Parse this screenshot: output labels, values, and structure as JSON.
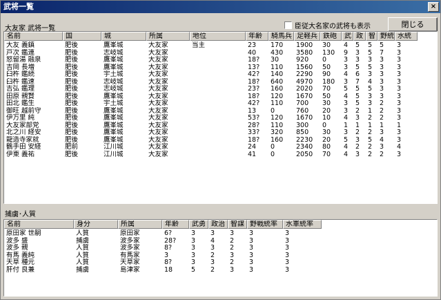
{
  "window": {
    "title": "武将一覧",
    "close_glyph": "×"
  },
  "top": {
    "section_label": "大友家 武将一覧",
    "checkbox_label": "臣従大名家の武将も表示",
    "close_button": "閉じる"
  },
  "officers": {
    "columns": [
      "名前",
      "国",
      "城",
      "所属",
      "地位",
      "年齢",
      "騎馬兵",
      "足軽兵",
      "鉄砲",
      "武",
      "政",
      "智",
      "野統",
      "水統"
    ],
    "rows": [
      [
        "大友 義鎮",
        "肥後",
        "鷹峯城",
        "大友家",
        "当主",
        "23",
        "170",
        "1900",
        "30",
        "4",
        "5",
        "5",
        "5",
        "3"
      ],
      [
        "戸次 鑑連",
        "肥後",
        "志岐城",
        "大友家",
        "",
        "40",
        "430",
        "3580",
        "130",
        "9",
        "3",
        "5",
        "7",
        "3"
      ],
      [
        "怒留湯 融泉",
        "肥後",
        "鷹峯城",
        "大友家",
        "",
        "18?",
        "30",
        "920",
        "0",
        "3",
        "3",
        "3",
        "3",
        "3"
      ],
      [
        "吉岡 長増",
        "肥後",
        "鷹峯城",
        "大友家",
        "",
        "13?",
        "110",
        "1560",
        "50",
        "3",
        "5",
        "5",
        "3",
        "3"
      ],
      [
        "臼杵 鑑続",
        "肥後",
        "宇土城",
        "大友家",
        "",
        "42?",
        "140",
        "2290",
        "90",
        "4",
        "6",
        "3",
        "3",
        "3"
      ],
      [
        "臼杵 鑑速",
        "肥後",
        "志岐城",
        "大友家",
        "",
        "18?",
        "640",
        "4970",
        "180",
        "3",
        "7",
        "4",
        "3",
        "3"
      ],
      [
        "吉弘 鑑理",
        "肥後",
        "志岐城",
        "大友家",
        "",
        "23?",
        "160",
        "2020",
        "70",
        "5",
        "5",
        "5",
        "3",
        "3"
      ],
      [
        "田原 親賢",
        "肥後",
        "鷹峯城",
        "大友家",
        "",
        "18?",
        "120",
        "1670",
        "50",
        "4",
        "5",
        "3",
        "3",
        "3"
      ],
      [
        "田北 鑑生",
        "肥後",
        "宇土城",
        "大友家",
        "",
        "42?",
        "110",
        "700",
        "30",
        "3",
        "5",
        "3",
        "2",
        "3"
      ],
      [
        "御旺 越前守",
        "肥後",
        "鷹峯城",
        "大友家",
        "",
        "13",
        "0",
        "760",
        "20",
        "3",
        "2",
        "1",
        "2",
        "3"
      ],
      [
        "伊万里 純",
        "肥後",
        "鷹峯城",
        "大友家",
        "",
        "53?",
        "120",
        "1670",
        "10",
        "4",
        "3",
        "2",
        "2",
        "3"
      ],
      [
        "大友家部党",
        "肥後",
        "鷹峯城",
        "大友家",
        "",
        "28?",
        "110",
        "300",
        "0",
        "1",
        "1",
        "1",
        "1",
        "1"
      ],
      [
        "北之川 経安",
        "肥後",
        "鷹峯城",
        "大友家",
        "",
        "33?",
        "320",
        "850",
        "30",
        "3",
        "2",
        "2",
        "3",
        "3"
      ],
      [
        "龍造寺家就",
        "肥後",
        "鷹峯城",
        "大友家",
        "",
        "18?",
        "160",
        "2230",
        "20",
        "5",
        "3",
        "5",
        "4",
        "3"
      ],
      [
        "鶴手田 安経",
        "肥前",
        "江川城",
        "大友家",
        "",
        "24",
        "0",
        "2340",
        "80",
        "4",
        "2",
        "2",
        "3",
        "4"
      ],
      [
        "伊東 義祐",
        "肥後",
        "江川城",
        "大友家",
        "",
        "41",
        "0",
        "2050",
        "70",
        "4",
        "3",
        "2",
        "2",
        "3"
      ]
    ]
  },
  "captives": {
    "section_label": "捕虜･人質",
    "columns": [
      "名前",
      "身分",
      "所属",
      "年齢",
      "武勇",
      "政治",
      "智謀",
      "野戦統率",
      "水軍統率"
    ],
    "rows": [
      [
        "原田家 世嗣",
        "人質",
        "原田家",
        "6?",
        "3",
        "3",
        "3",
        "3",
        "3"
      ],
      [
        "波多 盛",
        "捕虜",
        "波多家",
        "28?",
        "3",
        "4",
        "2",
        "3",
        "3"
      ],
      [
        "波多 親",
        "人質",
        "波多家",
        "8?",
        "3",
        "3",
        "2",
        "3",
        "3"
      ],
      [
        "有馬 義純",
        "人質",
        "有馬家",
        "3",
        "3",
        "2",
        "3",
        "3",
        "3"
      ],
      [
        "天草 種元",
        "人質",
        "天草家",
        "8?",
        "3",
        "3",
        "2",
        "3",
        "3"
      ],
      [
        "肝付 良兼",
        "捕虜",
        "島津家",
        "18",
        "5",
        "2",
        "3",
        "3",
        "3"
      ]
    ]
  }
}
